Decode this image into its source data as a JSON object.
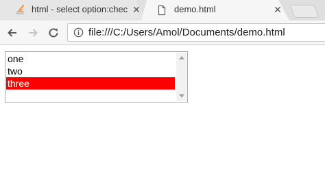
{
  "tabs": [
    {
      "title": "html - select option:checked",
      "close": "✕",
      "icon": "stack-overflow-icon"
    },
    {
      "title": "demo.html",
      "close": "✕",
      "icon": "document-icon"
    }
  ],
  "toolbar": {
    "back_icon": "back-arrow-icon",
    "forward_icon": "forward-arrow-icon",
    "reload_icon": "reload-icon",
    "url": "file:///C:/Users/Amol/Documents/demo.html"
  },
  "listbox": {
    "options": [
      "one",
      "two",
      "three"
    ],
    "selected_index": 2,
    "selected_color": "#ff0000"
  }
}
